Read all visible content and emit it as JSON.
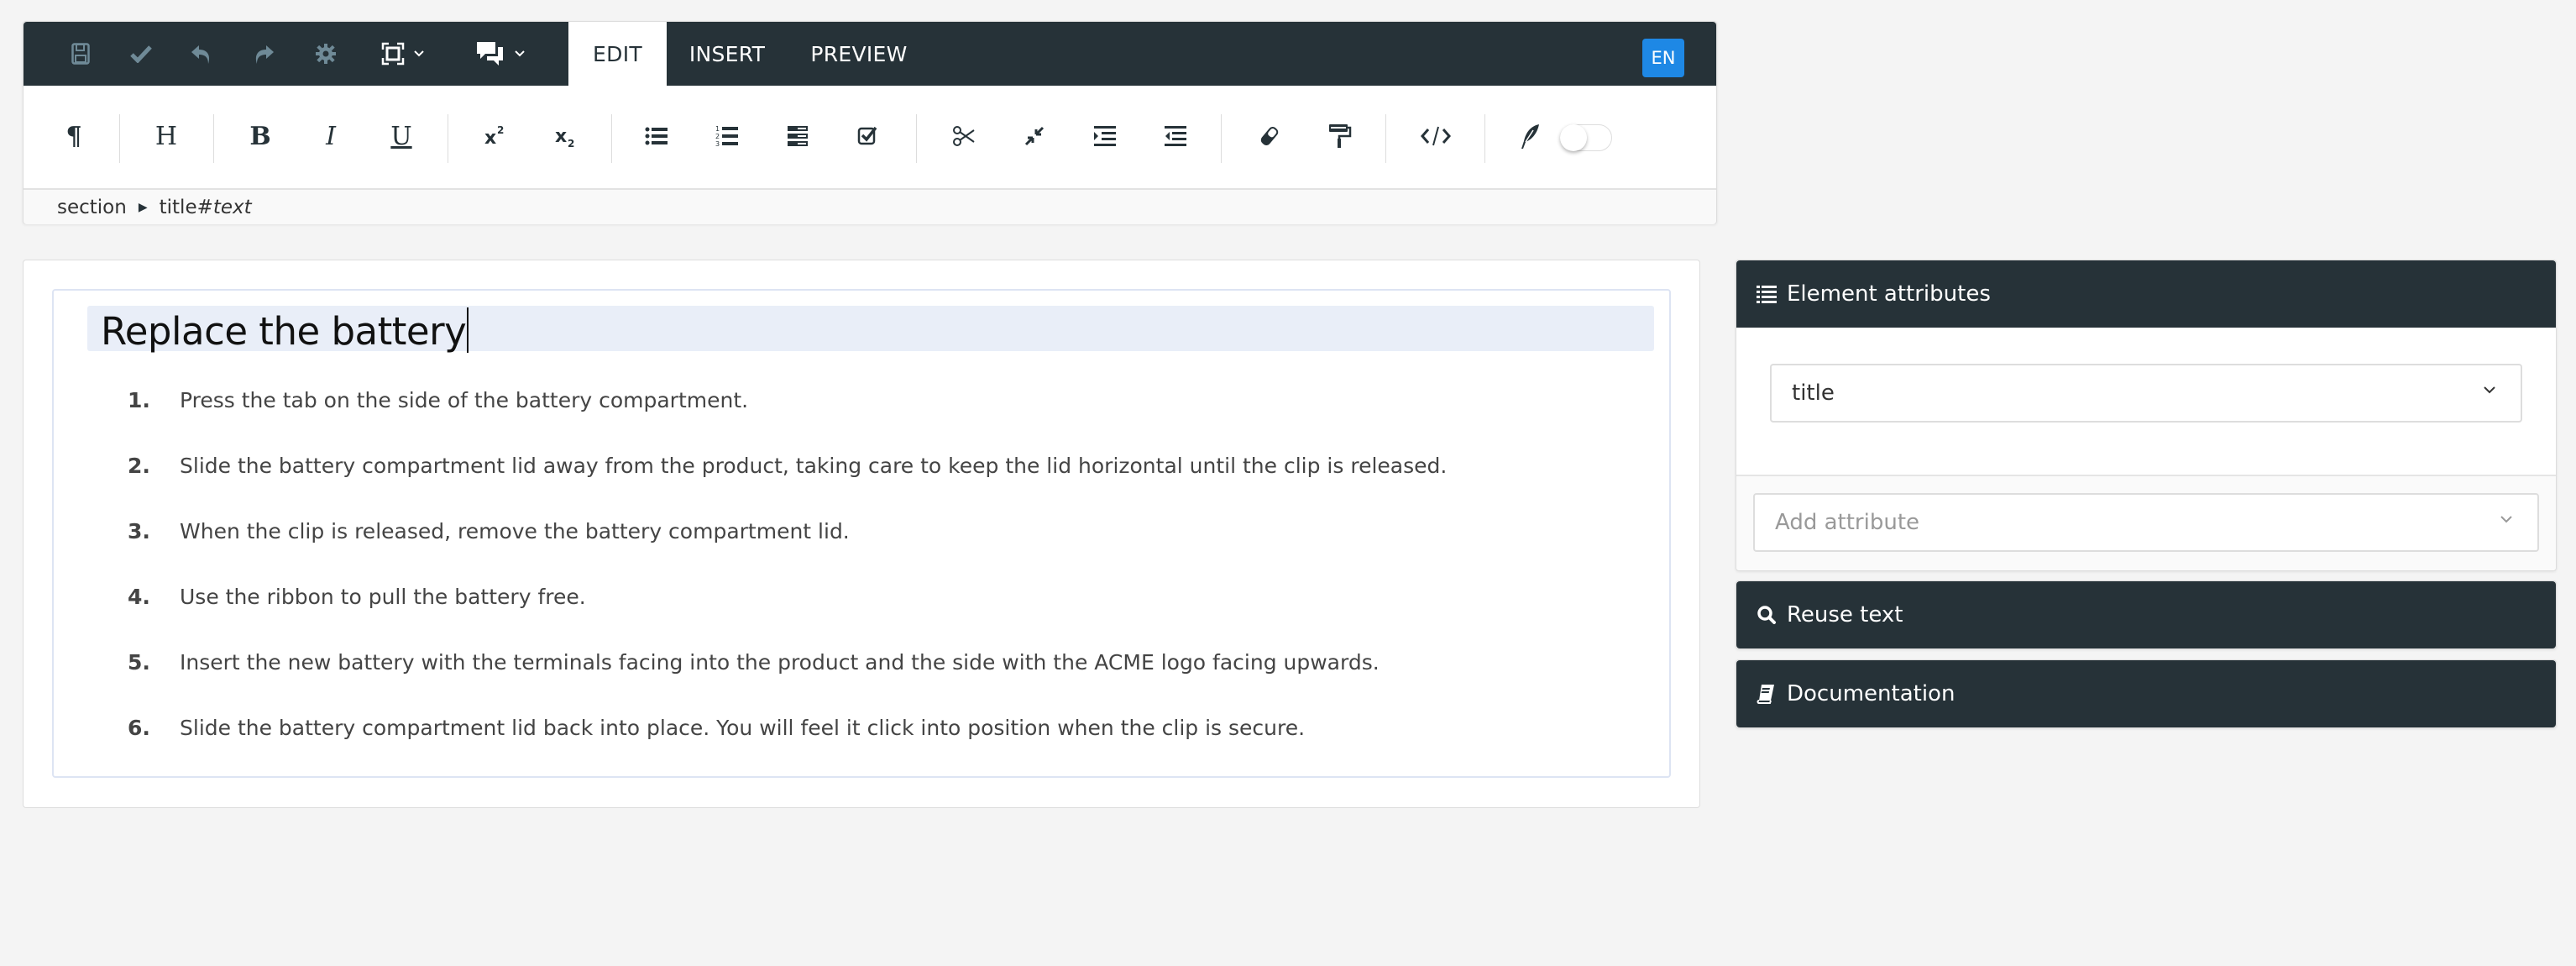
{
  "topbar": {
    "buttons": [
      {
        "name": "save",
        "icon": "save-icon"
      },
      {
        "name": "validate",
        "icon": "check-icon"
      },
      {
        "name": "undo",
        "icon": "undo-icon"
      },
      {
        "name": "redo",
        "icon": "redo-icon"
      },
      {
        "name": "settings",
        "icon": "gear-icon"
      },
      {
        "name": "fullscreen",
        "icon": "fullscreen-icon",
        "has_dropdown": true
      },
      {
        "name": "comments",
        "icon": "comments-icon",
        "has_dropdown": true
      }
    ],
    "tabs": [
      {
        "label": "EDIT",
        "active": true
      },
      {
        "label": "INSERT",
        "active": false
      },
      {
        "label": "PREVIEW",
        "active": false
      }
    ],
    "language": "EN",
    "accent_color": "#1e88e5",
    "bar_color": "#263238"
  },
  "toolbar": {
    "groups": [
      [
        "paragraph"
      ],
      [
        "heading"
      ],
      [
        "bold",
        "italic",
        "underline"
      ],
      [
        "superscript",
        "subscript"
      ],
      [
        "bulleted-list",
        "numbered-list",
        "definition-list",
        "checklist"
      ],
      [
        "split",
        "join",
        "indent",
        "outdent"
      ],
      [
        "clear-formatting",
        "format-painter"
      ],
      [
        "source-code"
      ],
      [
        "writing-mode"
      ]
    ],
    "labels": {
      "paragraph": "¶",
      "heading": "H",
      "bold": "B",
      "italic": "I",
      "underline": "U"
    },
    "toggle_on": false
  },
  "breadcrumb": {
    "items": [
      "section",
      "title"
    ],
    "suffix": "#",
    "suffix_em": "text"
  },
  "document": {
    "title": "Replace the battery",
    "steps": [
      {
        "num": "1.",
        "text": "Press the tab on the side of the battery compartment."
      },
      {
        "num": "2.",
        "text": "Slide the battery compartment lid away from the product, taking care to keep the lid horizontal until the clip is released."
      },
      {
        "num": "3.",
        "text": "When the clip is released, remove the battery compartment lid."
      },
      {
        "num": "4.",
        "text": "Use the ribbon to pull the battery free."
      },
      {
        "num": "5.",
        "text": "Insert the new battery with the terminals facing into the product and the side with the ACME logo facing upwards."
      },
      {
        "num": "6.",
        "text": "Slide the battery compartment lid back into place. You will feel it click into position when the clip is secure."
      }
    ]
  },
  "sidebar": {
    "element_attributes": {
      "heading": "Element attributes",
      "element_value": "title",
      "add_attribute_placeholder": "Add attribute"
    },
    "reuse_text": {
      "heading": "Reuse text"
    },
    "documentation": {
      "heading": "Documentation"
    }
  }
}
